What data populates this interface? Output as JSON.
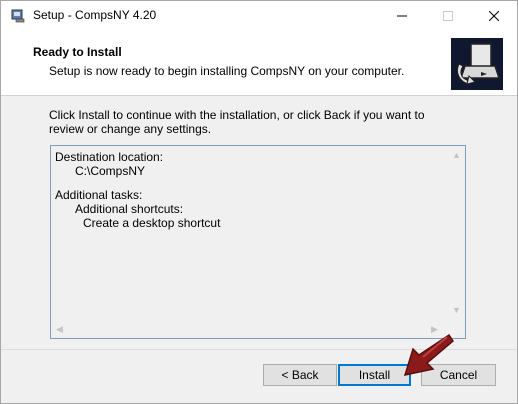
{
  "window": {
    "title": "Setup - CompsNY 4.20",
    "controls": {
      "minimize": "minimize",
      "maximize": "maximize",
      "close": "close"
    }
  },
  "header": {
    "title": "Ready to Install",
    "subtitle": "Setup is now ready to begin installing CompsNY on your computer."
  },
  "body": {
    "intro": "Click Install to continue with the installation, or click Back if you want to review or change any settings.",
    "memo_lines": [
      "Destination location:",
      "C:\\CompsNY",
      "",
      "Additional tasks:",
      "Additional shortcuts:",
      "Create a desktop shortcut"
    ]
  },
  "buttons": {
    "back": "< Back",
    "install": "Install",
    "cancel": "Cancel"
  },
  "colors": {
    "focus_border": "#0078d7",
    "pointer_arrow": "#8b1a1a",
    "header_image_bg": "#101830"
  }
}
